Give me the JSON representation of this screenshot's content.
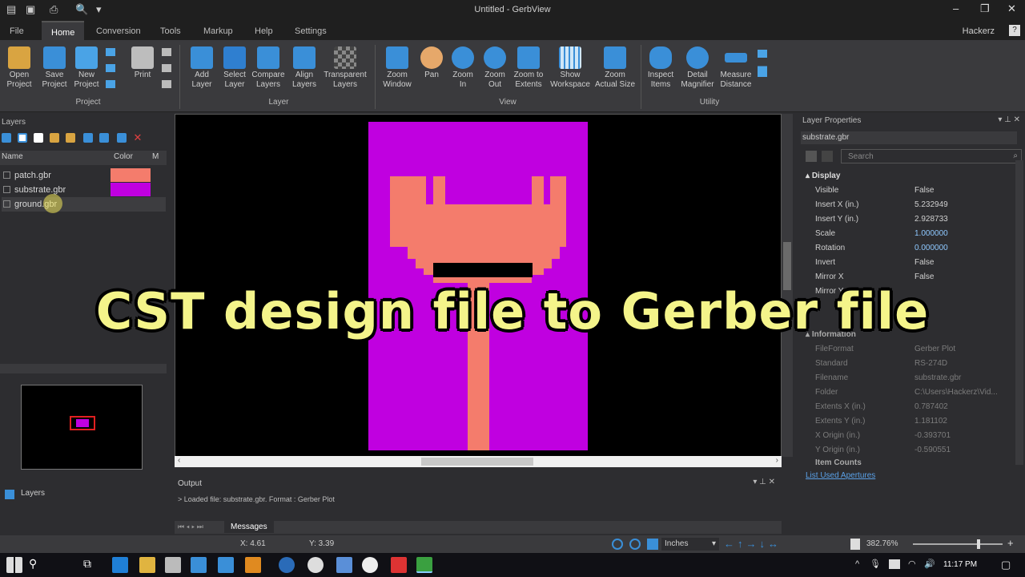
{
  "window": {
    "title": "Untitled - GerbView"
  },
  "menu": {
    "tabs": [
      "File",
      "Home",
      "Conversion",
      "Tools",
      "Markup",
      "Help",
      "Settings"
    ],
    "user": "Hackerz"
  },
  "ribbon": {
    "project": [
      {
        "l1": "Open",
        "l2": "Project",
        "icon": "folder-open-icon"
      },
      {
        "l1": "Save",
        "l2": "Project",
        "icon": "save-project-icon"
      },
      {
        "l1": "New",
        "l2": "Project",
        "icon": "new-project-icon"
      },
      {
        "l1": "Print",
        "l2": "",
        "icon": "print-icon"
      }
    ],
    "layer": [
      {
        "l1": "Add",
        "l2": "Layer",
        "icon": "add-layer-icon"
      },
      {
        "l1": "Select",
        "l2": "Layer",
        "icon": "select-layer-icon"
      },
      {
        "l1": "Compare",
        "l2": "Layers",
        "icon": "compare-layers-icon"
      },
      {
        "l1": "Align",
        "l2": "Layers",
        "icon": "align-layers-icon"
      },
      {
        "l1": "Transparent",
        "l2": "Layers",
        "icon": "transparent-layers-icon"
      }
    ],
    "view": [
      {
        "l1": "Zoom",
        "l2": "Window",
        "icon": "zoom-window-icon"
      },
      {
        "l1": "Pan",
        "l2": "",
        "icon": "pan-hand-icon"
      },
      {
        "l1": "Zoom",
        "l2": "In",
        "icon": "zoom-in-icon"
      },
      {
        "l1": "Zoom",
        "l2": "Out",
        "icon": "zoom-out-icon"
      },
      {
        "l1": "Zoom to",
        "l2": "Extents",
        "icon": "zoom-extents-icon"
      },
      {
        "l1": "Show",
        "l2": "Workspace",
        "icon": "workspace-grid-icon"
      },
      {
        "l1": "Zoom",
        "l2": "Actual Size",
        "icon": "zoom-actual-icon"
      }
    ],
    "utility": [
      {
        "l1": "Inspect",
        "l2": "Items",
        "icon": "inspect-glasses-icon"
      },
      {
        "l1": "Detail",
        "l2": "Magnifier",
        "icon": "magnifier-icon"
      },
      {
        "l1": "Measure",
        "l2": "Distance",
        "icon": "ruler-icon"
      }
    ],
    "groups": {
      "project": "Project",
      "layer": "Layer",
      "view": "View",
      "utility": "Utility"
    }
  },
  "layers_panel": {
    "title": "Layers",
    "columns": {
      "name": "Name",
      "color": "Color",
      "m": "M"
    },
    "rows": [
      {
        "name": "patch.gbr",
        "color": "#f47c6c"
      },
      {
        "name": "substrate.gbr",
        "color": "#c000e0"
      },
      {
        "name": "ground.gbr",
        "color": ""
      }
    ],
    "bottom_tab": "Layers"
  },
  "properties": {
    "title": "Layer Properties",
    "selected": "substrate.gbr",
    "search_placeholder": "Search",
    "display_header": "Display",
    "display": [
      {
        "k": "Visible",
        "v": "False"
      },
      {
        "k": "Insert X (in.)",
        "v": "5.232949"
      },
      {
        "k": "Insert Y (in.)",
        "v": "2.928733"
      },
      {
        "k": "Scale",
        "v": "1.000000"
      },
      {
        "k": "Rotation",
        "v": "0.000000"
      },
      {
        "k": "Invert",
        "v": "False"
      },
      {
        "k": "Mirror X",
        "v": "False"
      },
      {
        "k": "Mirror Y",
        "v": ""
      }
    ],
    "info_header": "Information",
    "info": [
      {
        "k": "FileFormat",
        "v": "Gerber Plot"
      },
      {
        "k": "Standard",
        "v": "RS-274D"
      },
      {
        "k": "Filename",
        "v": "substrate.gbr"
      },
      {
        "k": "Folder",
        "v": "C:\\Users\\Hackerz\\Vid..."
      },
      {
        "k": "Extents X (in.)",
        "v": "0.787402"
      },
      {
        "k": "Extents Y (in.)",
        "v": "1.181102"
      },
      {
        "k": "X Origin (in.)",
        "v": "-0.393701"
      },
      {
        "k": "Y Origin (in.)",
        "v": "-0.590551"
      }
    ],
    "item_counts": "Item Counts",
    "link": "List Used Apertures"
  },
  "output": {
    "title": "Output",
    "line": "> Loaded file: substrate.gbr. Format : Gerber Plot",
    "tab": "Messages"
  },
  "status": {
    "x": "X: 4.61",
    "y": "Y: 3.39",
    "units": "Inches",
    "zoom": "382.76%"
  },
  "taskbar": {
    "time": "11:17 PM"
  },
  "caption": "CST design file to Gerber file"
}
